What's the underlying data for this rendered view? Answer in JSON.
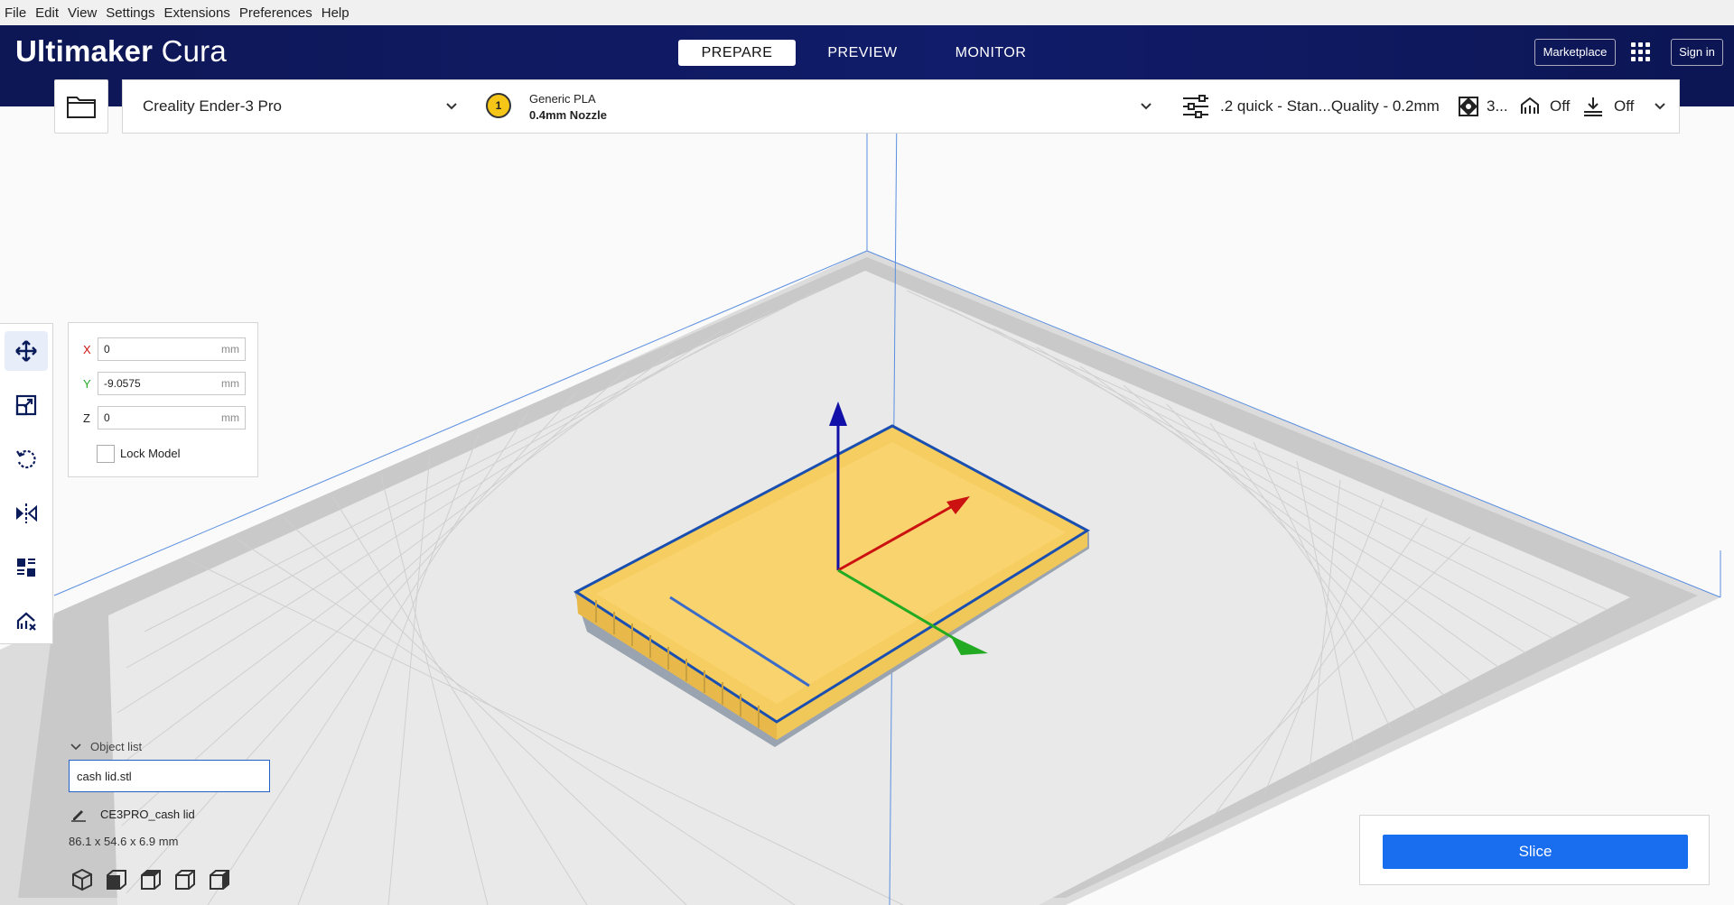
{
  "menu": [
    "File",
    "Edit",
    "View",
    "Settings",
    "Extensions",
    "Preferences",
    "Help"
  ],
  "header": {
    "logo_bold": "Ultimaker",
    "logo_light": "Cura",
    "tabs": [
      "PREPARE",
      "PREVIEW",
      "MONITOR"
    ],
    "active_tab": "PREPARE",
    "marketplace": "Marketplace",
    "signin": "Sign in"
  },
  "toolbar": {
    "printer": "Creality Ender-3 Pro",
    "extruder_number": "1",
    "material": "Generic PLA",
    "nozzle": "0.4mm Nozzle",
    "profile": ".2 quick - Stan...Quality - 0.2mm",
    "infill": "3...",
    "support": "Off",
    "adhesion": "Off"
  },
  "move_panel": {
    "x_label": "X",
    "x_value": "0",
    "y_label": "Y",
    "y_value": "-9.0575",
    "z_label": "Z",
    "z_value": "0",
    "unit": "mm",
    "lock_model": "Lock Model"
  },
  "object_list": {
    "title": "Object list",
    "filename": "cash lid.stl",
    "model_name": "CE3PRO_cash lid",
    "dimensions": "86.1 x 54.6 x 6.9 mm"
  },
  "slice": {
    "button": "Slice"
  },
  "colors": {
    "header_bg": "#0c1654",
    "accent": "#196ef0",
    "model_fill": "#f6cd60",
    "model_outline": "#1a4fb0",
    "axis_x": "#cc1111",
    "axis_y": "#22aa22",
    "axis_z": "#1111aa"
  },
  "icons": {
    "tools": [
      "move-icon",
      "scale-icon",
      "rotate-icon",
      "mirror-icon",
      "per-model-settings-icon",
      "support-blocker-icon"
    ],
    "views": [
      "view-3d-icon",
      "view-front-icon",
      "view-top-icon",
      "view-left-icon",
      "view-right-icon"
    ]
  }
}
